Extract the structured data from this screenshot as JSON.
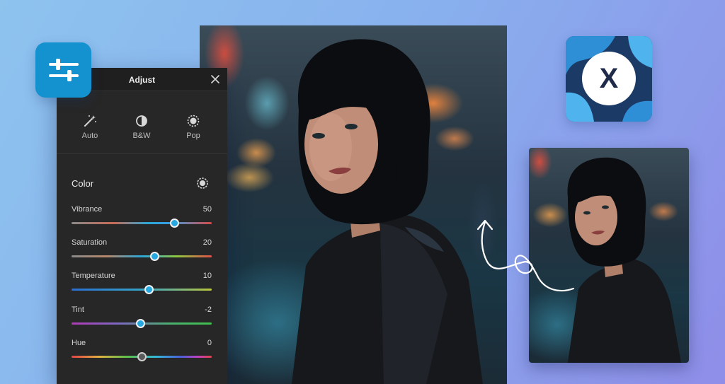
{
  "panel": {
    "title": "Adjust",
    "presets": [
      {
        "label": "Auto",
        "icon": "magic-wand-icon"
      },
      {
        "label": "B&W",
        "icon": "contrast-icon"
      },
      {
        "label": "Pop",
        "icon": "sun-icon"
      }
    ],
    "section_title": "Color",
    "sliders": [
      {
        "label": "Vibrance",
        "value": "50",
        "position": 0.73
      },
      {
        "label": "Saturation",
        "value": "20",
        "position": 0.59
      },
      {
        "label": "Temperature",
        "value": "10",
        "position": 0.55
      },
      {
        "label": "Tint",
        "value": "-2",
        "position": 0.49
      },
      {
        "label": "Hue",
        "value": "0",
        "position": 0.5
      }
    ]
  },
  "app_icons": {
    "adjust_app": "sliders-icon",
    "x_app_letter": "X"
  },
  "colors": {
    "accent": "#27a8e0",
    "panel_bg": "#272727",
    "adjust_icon_bg": "#1492cf"
  }
}
